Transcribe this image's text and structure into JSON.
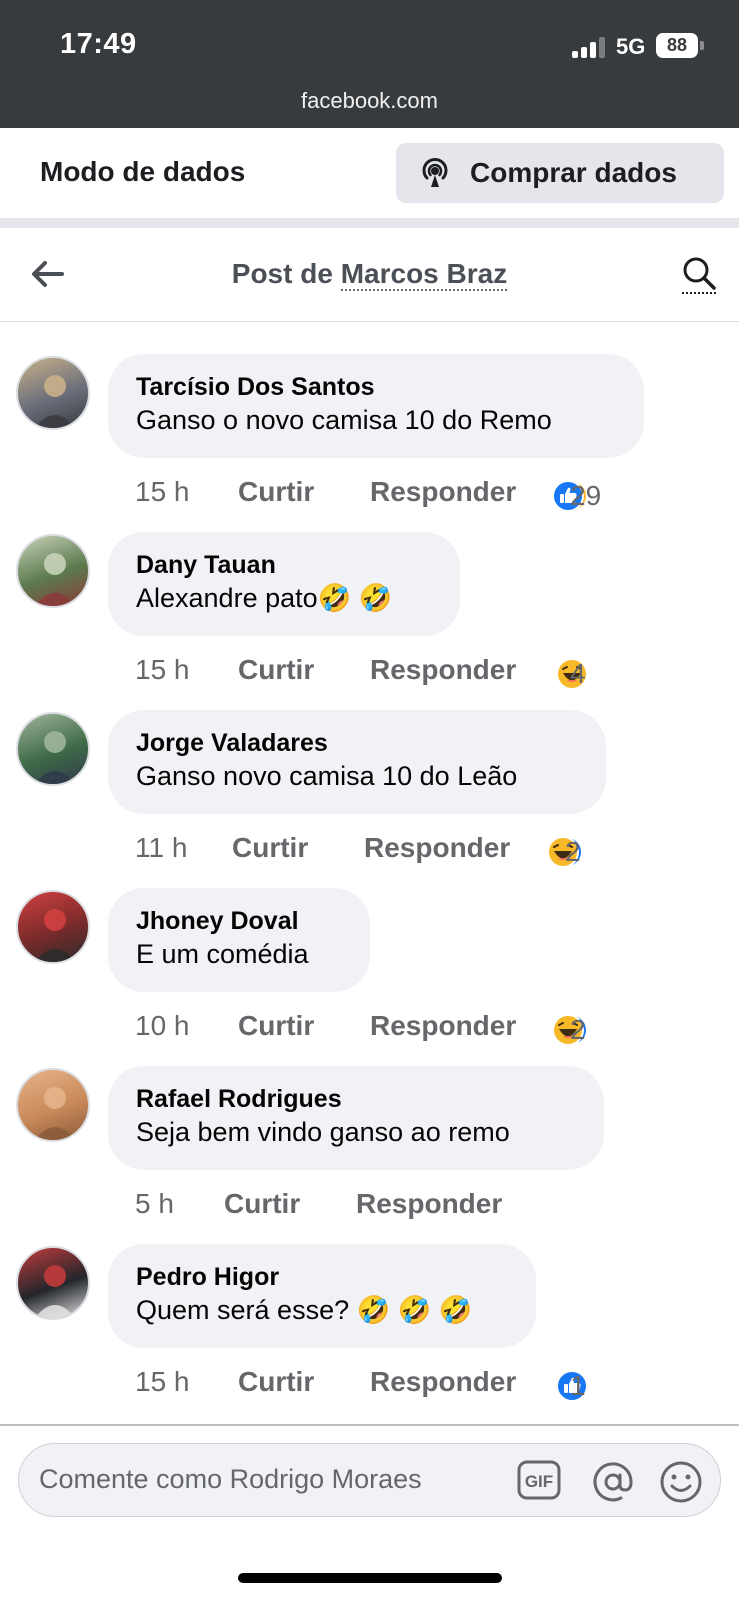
{
  "status": {
    "time": "17:49",
    "network": "5G",
    "battery": "88",
    "url": "facebook.com"
  },
  "databar": {
    "title": "Modo de dados",
    "buy_label": "Comprar dados"
  },
  "header": {
    "title_prefix": "Post de ",
    "author": "Marcos Braz"
  },
  "colors": {
    "like_blue": "#1877f2",
    "haha_yellow": "#f7b928",
    "bubble_bg": "#f0f2f5",
    "meta_gray": "#65676b"
  },
  "comments": [
    {
      "name": "Tarcísio Dos Santos",
      "text": "Ganso o novo camisa 10 do Remo",
      "time": "15 h",
      "like": "Curtir",
      "reply": "Responder",
      "reactions": [
        "haha",
        "like"
      ],
      "count": "29"
    },
    {
      "name": "Dany Tauan",
      "text": "Alexandre pato🤣 🤣",
      "time": "15 h",
      "like": "Curtir",
      "reply": "Responder",
      "reactions": [
        "haha"
      ],
      "count": "4"
    },
    {
      "name": "Jorge Valadares",
      "text": "Ganso novo camisa 10 do Leão",
      "time": "11 h",
      "like": "Curtir",
      "reply": "Responder",
      "reactions": [
        "like",
        "haha"
      ],
      "count": "2"
    },
    {
      "name": "Jhoney Doval",
      "text": "E um comédia",
      "time": "10 h",
      "like": "Curtir",
      "reply": "Responder",
      "reactions": [
        "like",
        "haha"
      ],
      "count": "2"
    },
    {
      "name": "Rafael Rodrigues",
      "text": "Seja bem vindo ganso ao remo",
      "time": "5 h",
      "like": "Curtir",
      "reply": "Responder",
      "reactions": [],
      "count": ""
    },
    {
      "name": "Pedro Higor",
      "text": "Quem será esse? 🤣 🤣 🤣",
      "time": "15 h",
      "like": "Curtir",
      "reply": "Responder",
      "reactions": [
        "like"
      ],
      "count": "1"
    }
  ],
  "composer": {
    "placeholder": "Comente como Rodrigo Moraes",
    "gif_label": "GIF"
  }
}
